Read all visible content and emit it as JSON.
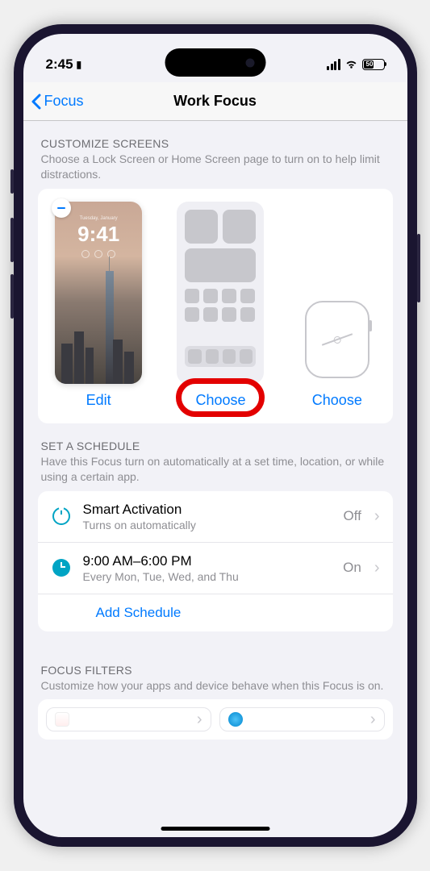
{
  "status": {
    "time": "2:45",
    "battery_pct": "50"
  },
  "nav": {
    "back_label": "Focus",
    "title": "Work Focus"
  },
  "customize": {
    "header": "CUSTOMIZE SCREENS",
    "desc": "Choose a Lock Screen or Home Screen page to turn on to help limit distractions.",
    "lock_screen": {
      "date": "Tuesday, January",
      "time": "9:41",
      "action": "Edit"
    },
    "home_screen": {
      "action": "Choose"
    },
    "watch": {
      "action": "Choose"
    }
  },
  "schedule": {
    "header": "SET A SCHEDULE",
    "desc": "Have this Focus turn on automatically at a set time, location, or while using a certain app.",
    "smart": {
      "title": "Smart Activation",
      "sub": "Turns on automatically",
      "value": "Off"
    },
    "time": {
      "title": "9:00 AM–6:00 PM",
      "sub": "Every Mon, Tue, Wed, and Thu",
      "value": "On"
    },
    "add": "Add Schedule"
  },
  "filters": {
    "header": "FOCUS FILTERS",
    "desc": "Customize how your apps and device behave when this Focus is on."
  }
}
